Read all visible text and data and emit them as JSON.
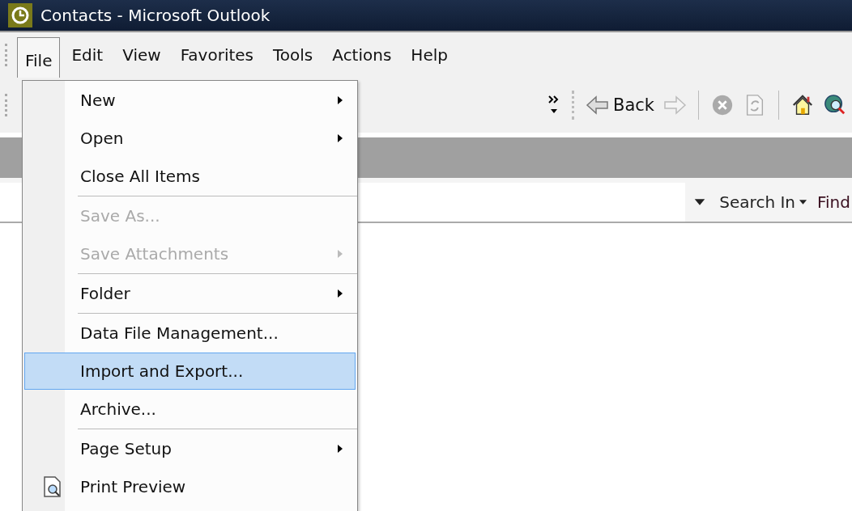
{
  "window": {
    "title": "Contacts - Microsoft Outlook"
  },
  "menu_bar": [
    {
      "label": "File",
      "selected": true
    },
    {
      "label": "Edit",
      "selected": false
    },
    {
      "label": "View",
      "selected": false
    },
    {
      "label": "Favorites",
      "selected": false
    },
    {
      "label": "Tools",
      "selected": false
    },
    {
      "label": "Actions",
      "selected": false
    },
    {
      "label": "Help",
      "selected": false
    }
  ],
  "toolbar": {
    "back_label": "Back"
  },
  "search_bar": {
    "search_in": "Search In",
    "find": "Find"
  },
  "file_menu": [
    {
      "kind": "item",
      "label": "New",
      "submenu": true,
      "disabled": false,
      "selected": false
    },
    {
      "kind": "item",
      "label": "Open",
      "submenu": true,
      "disabled": false,
      "selected": false
    },
    {
      "kind": "item",
      "label": "Close All Items",
      "submenu": false,
      "disabled": false,
      "selected": false
    },
    {
      "kind": "separator"
    },
    {
      "kind": "item",
      "label": "Save As...",
      "submenu": false,
      "disabled": true,
      "selected": false
    },
    {
      "kind": "item",
      "label": "Save Attachments",
      "submenu": true,
      "disabled": true,
      "selected": false
    },
    {
      "kind": "separator"
    },
    {
      "kind": "item",
      "label": "Folder",
      "submenu": true,
      "disabled": false,
      "selected": false
    },
    {
      "kind": "separator"
    },
    {
      "kind": "item",
      "label": "Data File Management...",
      "submenu": false,
      "disabled": false,
      "selected": false
    },
    {
      "kind": "item",
      "label": "Import and Export...",
      "submenu": false,
      "disabled": false,
      "selected": true
    },
    {
      "kind": "item",
      "label": "Archive...",
      "submenu": false,
      "disabled": false,
      "selected": false
    },
    {
      "kind": "separator"
    },
    {
      "kind": "item",
      "label": "Page Setup",
      "submenu": true,
      "disabled": false,
      "selected": false
    },
    {
      "kind": "icon_item",
      "label": "Print Preview",
      "submenu": false,
      "disabled": false,
      "selected": false
    }
  ]
}
